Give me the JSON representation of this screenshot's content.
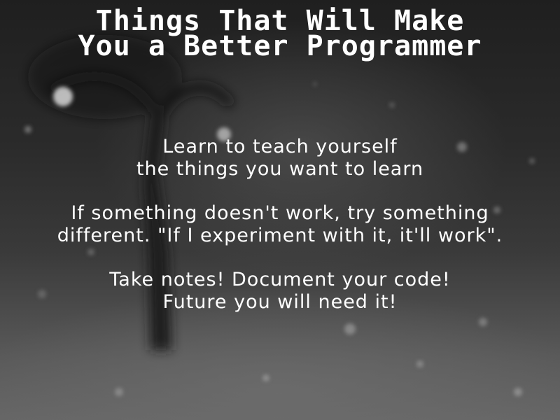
{
  "slide": {
    "title_lines": [
      "Things That Will Make",
      "You a Better Programmer"
    ],
    "tips": [
      {
        "lines": [
          "Learn to teach yourself",
          "the things you want to learn"
        ]
      },
      {
        "lines": [
          "If something doesn't work, try something",
          "different.  \"If I experiment with it, it'll work\"."
        ]
      },
      {
        "lines": [
          "Take notes!  Document your code!",
          "Future you will need it!"
        ]
      }
    ]
  }
}
